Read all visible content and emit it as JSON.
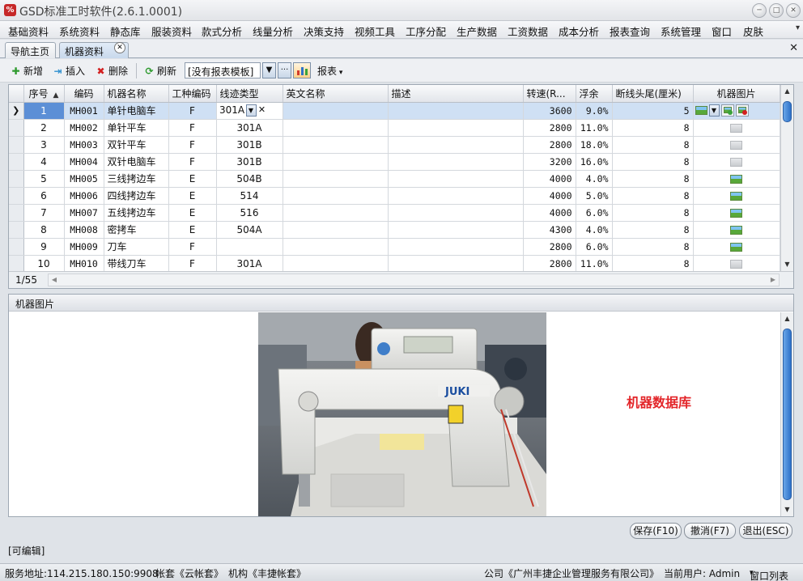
{
  "window": {
    "title": "GSD标准工时软件(2.6.1.0001)"
  },
  "menu": [
    "基础资料",
    "系统资料",
    "静态库",
    "服装资料",
    "款式分析",
    "线量分析",
    "决策支持",
    "视频工具",
    "工序分配",
    "生产数据",
    "工资数据",
    "成本分析",
    "报表查询",
    "系统管理",
    "窗口",
    "皮肤"
  ],
  "tabs": {
    "home": "导航主页",
    "machines": "机器资料"
  },
  "toolbar": {
    "add": "新增",
    "insert": "插入",
    "delete": "删除",
    "refresh": "刷新",
    "template_value": "[没有报表模板]",
    "report": "报表"
  },
  "grid": {
    "columns": [
      "序号",
      "编码",
      "机器名称",
      "工种编码",
      "线迹类型",
      "英文名称",
      "描述",
      "转速(R...",
      "浮余",
      "断线头尾(厘米)",
      "机器图片"
    ],
    "rows": [
      {
        "seq": "1",
        "code": "MH001",
        "name": "单针电脑车",
        "type": "F",
        "stitch": "301A",
        "en": "",
        "desc": "",
        "speed": "3600",
        "float": "9.0%",
        "tail": "5",
        "image": "yes"
      },
      {
        "seq": "2",
        "code": "MH002",
        "name": "单针平车",
        "type": "F",
        "stitch": "301A",
        "en": "",
        "desc": "",
        "speed": "2800",
        "float": "11.0%",
        "tail": "8",
        "image": "no"
      },
      {
        "seq": "3",
        "code": "MH003",
        "name": "双针平车",
        "type": "F",
        "stitch": "301B",
        "en": "",
        "desc": "",
        "speed": "2800",
        "float": "18.0%",
        "tail": "8",
        "image": "no"
      },
      {
        "seq": "4",
        "code": "MH004",
        "name": "双针电脑车",
        "type": "F",
        "stitch": "301B",
        "en": "",
        "desc": "",
        "speed": "3200",
        "float": "16.0%",
        "tail": "8",
        "image": "no"
      },
      {
        "seq": "5",
        "code": "MH005",
        "name": "三线拷边车",
        "type": "E",
        "stitch": "504B",
        "en": "",
        "desc": "",
        "speed": "4000",
        "float": "4.0%",
        "tail": "8",
        "image": "yes"
      },
      {
        "seq": "6",
        "code": "MH006",
        "name": "四线拷边车",
        "type": "E",
        "stitch": "514",
        "en": "",
        "desc": "",
        "speed": "4000",
        "float": "5.0%",
        "tail": "8",
        "image": "yes"
      },
      {
        "seq": "7",
        "code": "MH007",
        "name": "五线拷边车",
        "type": "E",
        "stitch": "516",
        "en": "",
        "desc": "",
        "speed": "4000",
        "float": "6.0%",
        "tail": "8",
        "image": "yes"
      },
      {
        "seq": "8",
        "code": "MH008",
        "name": "密拷车",
        "type": "E",
        "stitch": "504A",
        "en": "",
        "desc": "",
        "speed": "4300",
        "float": "4.0%",
        "tail": "8",
        "image": "yes"
      },
      {
        "seq": "9",
        "code": "MH009",
        "name": "刀车",
        "type": "F",
        "stitch": "",
        "en": "",
        "desc": "",
        "speed": "2800",
        "float": "6.0%",
        "tail": "8",
        "image": "yes"
      },
      {
        "seq": "10",
        "code": "MH010",
        "name": "带线刀车",
        "type": "F",
        "stitch": "301A",
        "en": "",
        "desc": "",
        "speed": "2800",
        "float": "11.0%",
        "tail": "8",
        "image": "no"
      }
    ],
    "page_count": "1/55"
  },
  "image_panel": {
    "title": "机器图片",
    "photo_brand": "JUKI",
    "watermark": "机器数据库"
  },
  "actions": {
    "save": "保存(F10)",
    "cancel": "撤消(F7)",
    "exit": "退出(ESC)"
  },
  "edit_status": "[可编辑]",
  "status": {
    "server": "服务地址:114.215.180.150:9908",
    "account": "帐套《云帐套》",
    "org": "机构《丰捷帐套》",
    "company": "公司《广州丰捷企业管理服务有限公司》",
    "user": "当前用户: Admin",
    "windows": "窗口列表"
  },
  "colors": {
    "selection": "#cfe0f4",
    "selected_cell": "#5c8fd6",
    "watermark": "#e3262a",
    "scroll_thumb": "#2e72c9"
  }
}
